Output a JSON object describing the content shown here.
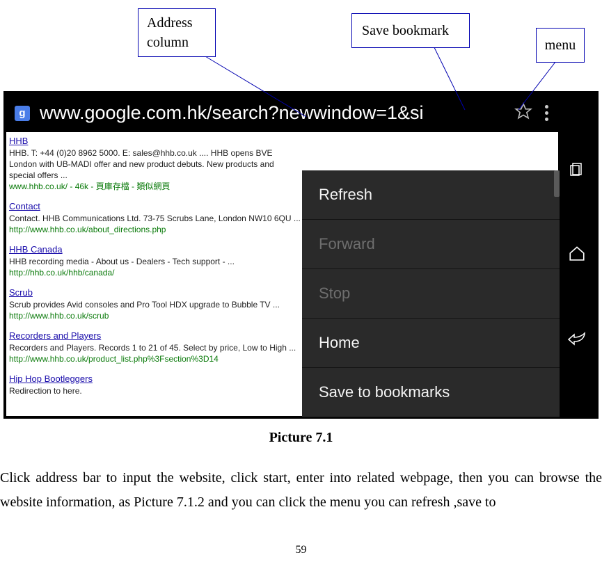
{
  "callouts": {
    "address": "Address column",
    "bookmark": "Save bookmark",
    "menu": "menu"
  },
  "browser": {
    "url": "www.google.com.hk/search?newwindow=1&si",
    "favicon_letter": "g"
  },
  "menu": {
    "items": [
      {
        "label": "Refresh",
        "enabled": true
      },
      {
        "label": "Forward",
        "enabled": false
      },
      {
        "label": "Stop",
        "enabled": false
      },
      {
        "label": "Home",
        "enabled": true
      },
      {
        "label": "Save to bookmarks",
        "enabled": true
      }
    ]
  },
  "results": [
    {
      "title": "HHB",
      "snippet": "HHB. T: +44 (0)20 8962 5000. E: sales@hhb.co.uk .... HHB opens BVE London with UB-MADI offer and new product debuts. New products and special offers ...",
      "url": "www.hhb.co.uk/ - 46k - 頁庫存檔 - 類似網頁"
    },
    {
      "title": "Contact",
      "snippet": "Contact. HHB Communications Ltd. 73-75 Scrubs Lane, London NW10 6QU ...",
      "url": "http://www.hhb.co.uk/about_directions.php"
    },
    {
      "title": "HHB Canada",
      "snippet": "HHB recording media - About us - Dealers - Tech support - ...",
      "url": "http://hhb.co.uk/hhb/canada/"
    },
    {
      "title": "Scrub",
      "snippet": "Scrub provides Avid consoles and Pro Tool HDX upgrade to Bubble TV ...",
      "url": "http://www.hhb.co.uk/scrub"
    },
    {
      "title": "Recorders and Players",
      "snippet": "Recorders and Players. Records 1 to 21 of 45. Select by price, Low to High ...",
      "url": "http://www.hhb.co.uk/product_list.php%3Fsection%3D14"
    },
    {
      "title": "Hip Hop Bootleggers",
      "snippet": "Redirection to here.",
      "url": ""
    }
  ],
  "caption": "Picture 7.1",
  "body_text": "Click address bar to input the website, click start, enter into related webpage, then you can browse the website information, as Picture 7.1.2 and you can click the menu you can refresh ,save to",
  "page_number": "59"
}
